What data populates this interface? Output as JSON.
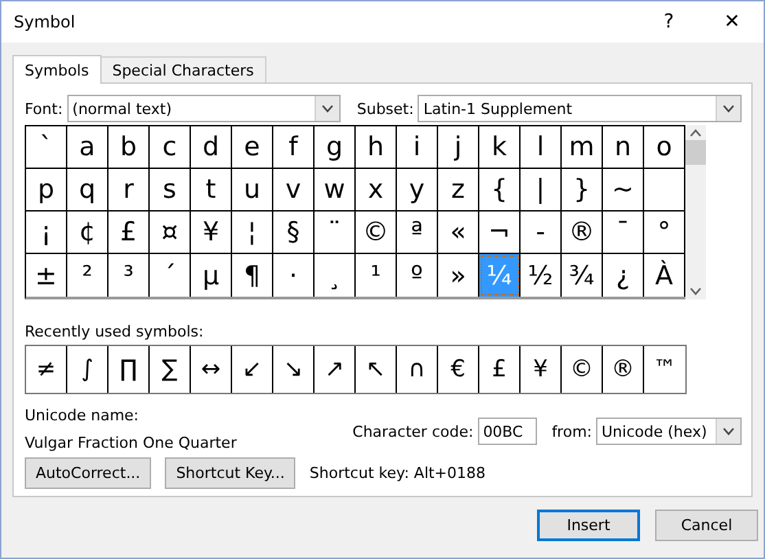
{
  "window": {
    "title": "Symbol",
    "help": "?",
    "close": "✕"
  },
  "tabs": [
    {
      "label": "Symbols",
      "selected": true
    },
    {
      "label": "Special Characters",
      "selected": false
    }
  ],
  "font": {
    "label": "Font:",
    "value": "(normal text)"
  },
  "subset": {
    "label": "Subset:",
    "value": "Latin-1 Supplement"
  },
  "grid": [
    {
      "char": "`",
      "selected": false
    },
    {
      "char": "a",
      "selected": false
    },
    {
      "char": "b",
      "selected": false
    },
    {
      "char": "c",
      "selected": false
    },
    {
      "char": "d",
      "selected": false
    },
    {
      "char": "e",
      "selected": false
    },
    {
      "char": "f",
      "selected": false
    },
    {
      "char": "g",
      "selected": false
    },
    {
      "char": "h",
      "selected": false
    },
    {
      "char": "i",
      "selected": false
    },
    {
      "char": "j",
      "selected": false
    },
    {
      "char": "k",
      "selected": false
    },
    {
      "char": "l",
      "selected": false
    },
    {
      "char": "m",
      "selected": false
    },
    {
      "char": "n",
      "selected": false
    },
    {
      "char": "o",
      "selected": false
    },
    {
      "char": "p",
      "selected": false
    },
    {
      "char": "q",
      "selected": false
    },
    {
      "char": "r",
      "selected": false
    },
    {
      "char": "s",
      "selected": false
    },
    {
      "char": "t",
      "selected": false
    },
    {
      "char": "u",
      "selected": false
    },
    {
      "char": "v",
      "selected": false
    },
    {
      "char": "w",
      "selected": false
    },
    {
      "char": "x",
      "selected": false
    },
    {
      "char": "y",
      "selected": false
    },
    {
      "char": "z",
      "selected": false
    },
    {
      "char": "{",
      "selected": false
    },
    {
      "char": "|",
      "selected": false
    },
    {
      "char": "}",
      "selected": false
    },
    {
      "char": "~",
      "selected": false
    },
    {
      "selected": false
    },
    {
      "char": "¡",
      "selected": false
    },
    {
      "char": "¢",
      "selected": false
    },
    {
      "char": "£",
      "selected": false
    },
    {
      "char": "¤",
      "selected": false
    },
    {
      "char": "¥",
      "selected": false
    },
    {
      "char": "¦",
      "selected": false
    },
    {
      "char": "§",
      "selected": false
    },
    {
      "char": "¨",
      "selected": false
    },
    {
      "char": "©",
      "selected": false
    },
    {
      "char": "ª",
      "selected": false
    },
    {
      "char": "«",
      "selected": false
    },
    {
      "char": "¬",
      "selected": false
    },
    {
      "char": "-",
      "selected": false
    },
    {
      "char": "®",
      "selected": false
    },
    {
      "char": "¯",
      "selected": false
    },
    {
      "char": "°",
      "selected": false
    },
    {
      "char": "±",
      "selected": false
    },
    {
      "char": "²",
      "selected": false
    },
    {
      "char": "³",
      "selected": false
    },
    {
      "char": "´",
      "selected": false
    },
    {
      "char": "µ",
      "selected": false
    },
    {
      "char": "¶",
      "selected": false
    },
    {
      "char": "·",
      "selected": false
    },
    {
      "char": "¸",
      "selected": false
    },
    {
      "char": "¹",
      "selected": false
    },
    {
      "char": "º",
      "selected": false
    },
    {
      "char": "»",
      "selected": false
    },
    {
      "char": "¼",
      "selected": true
    },
    {
      "char": "½",
      "selected": false
    },
    {
      "char": "¾",
      "selected": false
    },
    {
      "char": "¿",
      "selected": false
    },
    {
      "char": "À",
      "selected": false
    }
  ],
  "recent": {
    "label": "Recently used symbols:",
    "symbols": [
      "≠",
      "∫",
      "∏",
      "∑",
      "↔",
      "↙",
      "↘",
      "↗",
      "↖",
      "∩",
      "€",
      "£",
      "¥",
      "©",
      "®",
      "™"
    ]
  },
  "unicode_name": {
    "label": "Unicode name:",
    "value": "Vulgar Fraction One Quarter"
  },
  "character_code": {
    "label": "Character code:",
    "value": "00BC"
  },
  "from": {
    "label": "from:",
    "value": "Unicode (hex)"
  },
  "buttons": [
    "AutoCorrect...",
    "Shortcut Key..."
  ],
  "shortcut_info": "Shortcut key: Alt+0188",
  "footer_buttons": [
    {
      "label": "Insert",
      "default": true
    },
    {
      "label": "Cancel",
      "default": false
    }
  ]
}
